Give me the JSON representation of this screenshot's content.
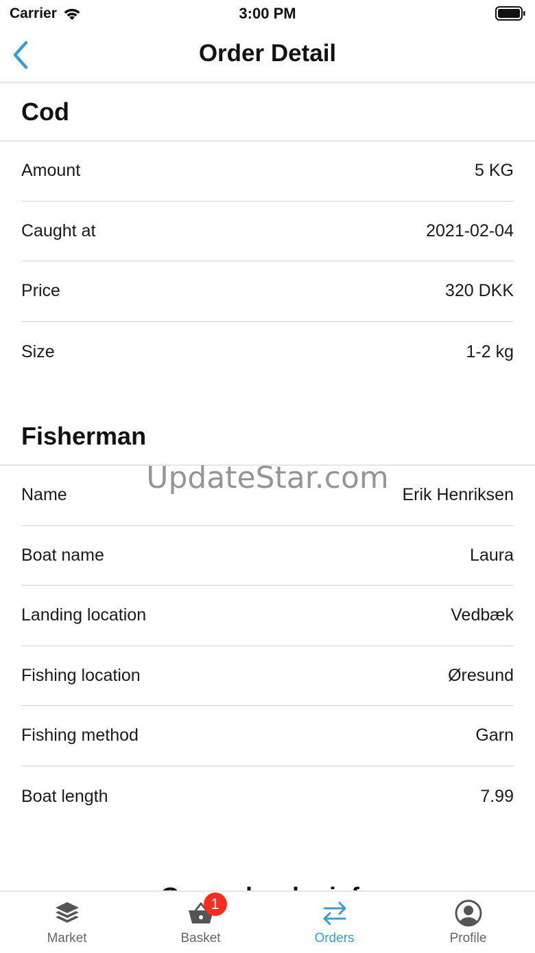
{
  "status_bar": {
    "carrier": "Carrier",
    "time": "3:00 PM"
  },
  "nav": {
    "title": "Order Detail",
    "back_icon": "chevron-left-icon",
    "accent_color": "#3d9bd4"
  },
  "product": {
    "title": "Cod",
    "rows": [
      {
        "label": "Amount",
        "value": "5 KG"
      },
      {
        "label": "Caught at",
        "value": "2021-02-04"
      },
      {
        "label": "Price",
        "value": "320 DKK"
      },
      {
        "label": "Size",
        "value": "1-2 kg"
      }
    ]
  },
  "fisherman": {
    "title": "Fisherman",
    "rows": [
      {
        "label": "Name",
        "value": "Erik Henriksen"
      },
      {
        "label": "Boat name",
        "value": "Laura"
      },
      {
        "label": "Landing location",
        "value": "Vedbæk"
      },
      {
        "label": "Fishing location",
        "value": "Øresund"
      },
      {
        "label": "Fishing method",
        "value": "Garn"
      },
      {
        "label": "Boat length",
        "value": "7.99"
      }
    ]
  },
  "general": {
    "title": "General order info"
  },
  "watermark": "UpdateStar.com",
  "tab_bar": {
    "tabs": [
      {
        "label": "Market",
        "icon": "layers-icon",
        "active": false
      },
      {
        "label": "Basket",
        "icon": "basket-icon",
        "active": false,
        "badge": "1"
      },
      {
        "label": "Orders",
        "icon": "swap-arrows-icon",
        "active": true
      },
      {
        "label": "Profile",
        "icon": "user-circle-icon",
        "active": false
      }
    ],
    "active_color": "#3d9bd4",
    "badge_color": "#ff2d1f"
  }
}
